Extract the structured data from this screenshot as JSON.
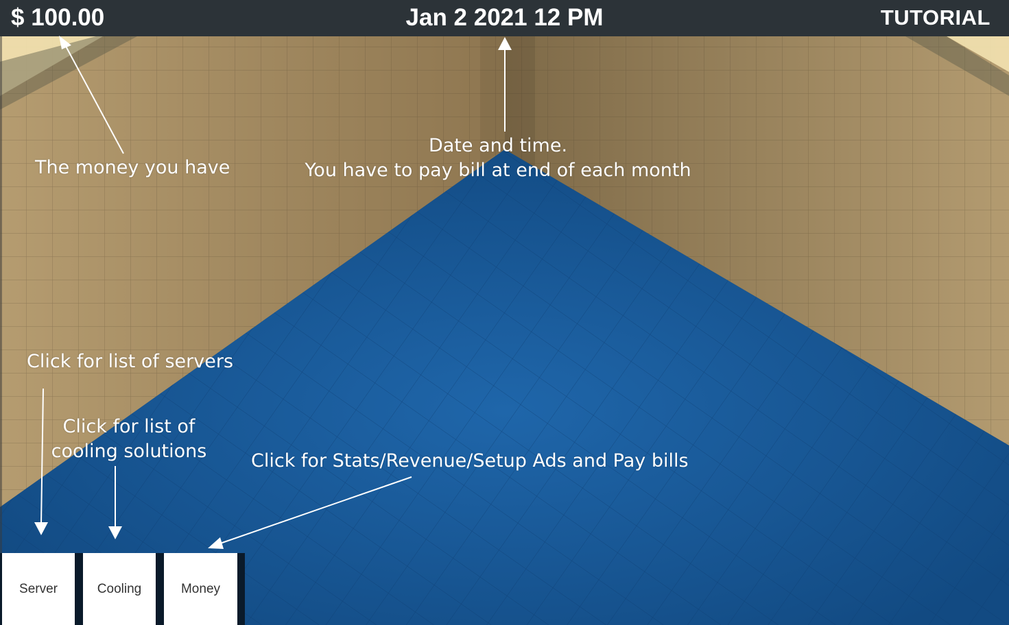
{
  "hud": {
    "money": "$ 100.00",
    "datetime": "Jan 2 2021 12 PM",
    "tutorial_label": "TUTORIAL"
  },
  "annotations": {
    "money": "The money you have",
    "datetime_line1": "Date and time.",
    "datetime_line2": "You have to pay bill at end of each month",
    "servers": "Click for list of servers",
    "cooling_line1": "Click for list of",
    "cooling_line2": "cooling solutions",
    "money_button": "Click for Stats/Revenue/Setup Ads and Pay bills"
  },
  "toolbar": {
    "server_label": "Server",
    "cooling_label": "Cooling",
    "money_label": "Money"
  },
  "colors": {
    "top_bar": "#2c3338",
    "floor": "#1a5a9a",
    "wall": "#a08860",
    "button": "#ffffff"
  }
}
